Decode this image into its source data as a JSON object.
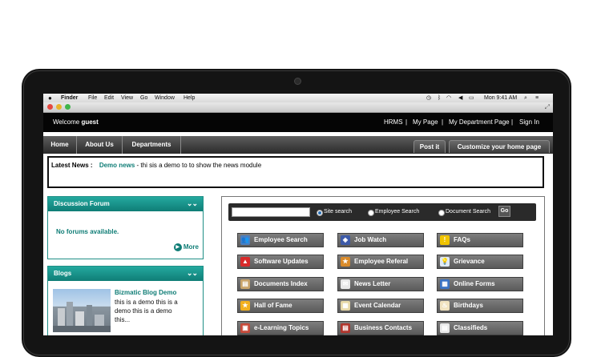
{
  "menubar": {
    "app": "Finder",
    "items": [
      "File",
      "Edit",
      "View",
      "Go",
      "Window",
      "Help"
    ],
    "clock": "Mon 9:41 AM"
  },
  "topbar": {
    "welcome_prefix": "Welcome",
    "user": "guest",
    "links": [
      "HRMS",
      "|",
      "My Page",
      "|",
      "My Department Page",
      "|",
      "Sign In"
    ]
  },
  "nav": {
    "items": [
      "Home",
      "About Us",
      "Departments"
    ],
    "post_it": "Post it",
    "customize": "Customize your home page"
  },
  "news": {
    "label": "Latest News :",
    "headline": "Demo news",
    "text": " - thi sis a demo to to show the news module"
  },
  "discussion": {
    "title": "Discussion Forum",
    "empty": "No forums available.",
    "more": "More"
  },
  "blogs": {
    "title": "Blogs",
    "post_title": "Bizmatic Blog Demo",
    "post_excerpt": "this is a demo this is a demo this is a demo this..."
  },
  "search": {
    "placeholder": "",
    "options": [
      "Site search",
      "Employee Search",
      "Document Search"
    ],
    "selected": "Site search",
    "go": "Go"
  },
  "tiles": [
    {
      "label": "Employee Search",
      "icon": "people-search-icon",
      "color": "#4a7fc1",
      "glyph": "👥"
    },
    {
      "label": "Job Watch",
      "icon": "badge-icon",
      "color": "#3d5aa8",
      "glyph": "◈"
    },
    {
      "label": "FAQs",
      "icon": "warning-icon",
      "color": "#f0c400",
      "glyph": "!"
    },
    {
      "label": "Software Updates",
      "icon": "alert-icon",
      "color": "#d82a2a",
      "glyph": "▲"
    },
    {
      "label": "Employee Referal",
      "icon": "referral-icon",
      "color": "#d98b2b",
      "glyph": "★"
    },
    {
      "label": "Grievance",
      "icon": "lightbulb-icon",
      "color": "#dfe9f5",
      "glyph": "💡"
    },
    {
      "label": "Documents Index",
      "icon": "document-icon",
      "color": "#c9a46a",
      "glyph": "▤"
    },
    {
      "label": "News Letter",
      "icon": "mail-icon",
      "color": "#e9e9e9",
      "glyph": "✉"
    },
    {
      "label": "Online Forms",
      "icon": "form-icon",
      "color": "#3a73c4",
      "glyph": "▦"
    },
    {
      "label": "Hall of Fame",
      "icon": "star-icon",
      "color": "#f2b01e",
      "glyph": "★"
    },
    {
      "label": "Event Calendar",
      "icon": "calendar-icon",
      "color": "#e8d9a8",
      "glyph": "▦"
    },
    {
      "label": "Birthdays",
      "icon": "cake-icon",
      "color": "#f1e3c0",
      "glyph": "♨"
    },
    {
      "label": "e-Learning Topics",
      "icon": "book-icon",
      "color": "#c64a3a",
      "glyph": "▣"
    },
    {
      "label": "Business Contacts",
      "icon": "contacts-icon",
      "color": "#b0362e",
      "glyph": "▤"
    },
    {
      "label": "Classifieds",
      "icon": "classifieds-icon",
      "color": "#e8e8e8",
      "glyph": "▤"
    }
  ],
  "colors": {
    "accent_teal": "#1f8f86",
    "nav_dark": "#2a2a2a",
    "link_teal": "#0f7d76"
  }
}
